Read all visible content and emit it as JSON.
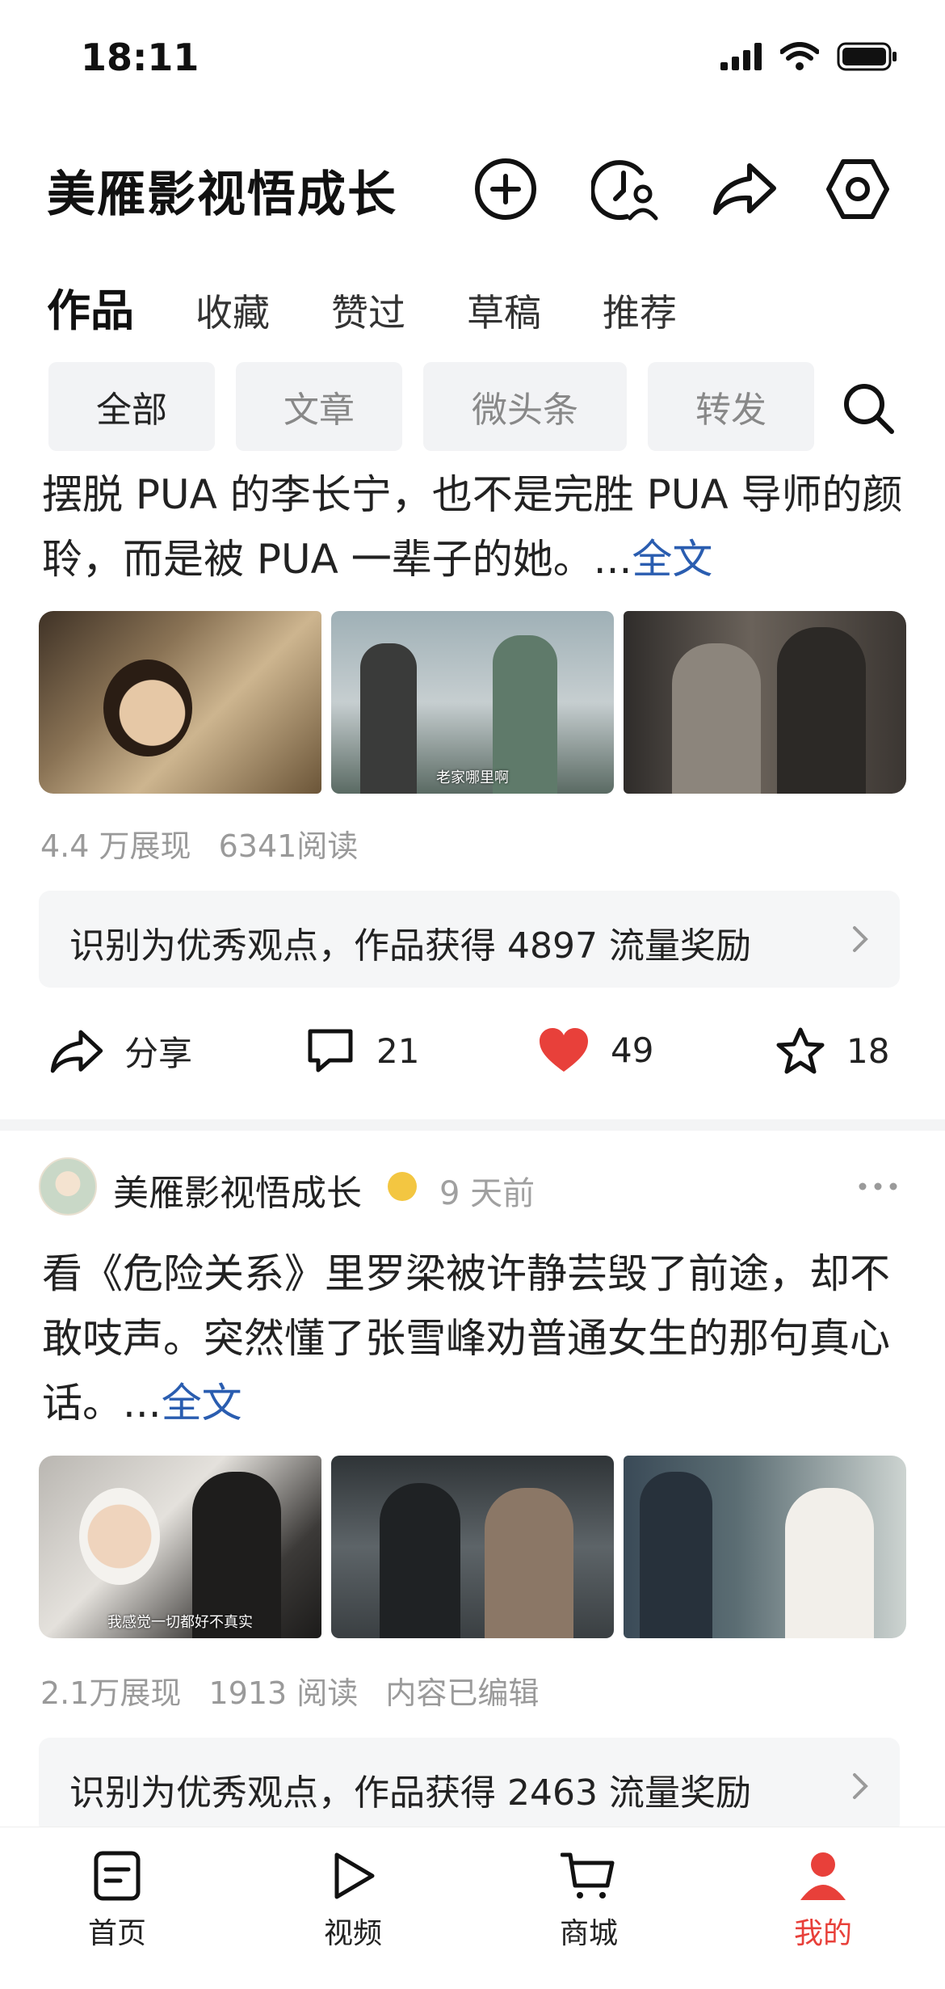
{
  "status_bar": {
    "time": "18:11"
  },
  "header": {
    "title": "美雁影视悟成长"
  },
  "tabs": [
    {
      "label": "作品",
      "active": true
    },
    {
      "label": "收藏"
    },
    {
      "label": "赞过"
    },
    {
      "label": "草稿"
    },
    {
      "label": "推荐"
    }
  ],
  "filters": [
    {
      "label": "全部",
      "active": true
    },
    {
      "label": "文章"
    },
    {
      "label": "微头条"
    },
    {
      "label": "转发"
    }
  ],
  "post1": {
    "text": "摆脱 PUA 的李长宁，也不是完胜 PUA 导师的颜聆，而是被 PUA 一辈子的她。...",
    "more": "全文",
    "image_caption": "老家哪里啊",
    "views": "4.4 万展现",
    "reads": "6341阅读",
    "reward": "识别为优秀观点，作品获得 4897 流量奖励",
    "share_label": "分享",
    "comments": "21",
    "likes": "49",
    "favorites": "18"
  },
  "post2": {
    "author": "美雁影视悟成长",
    "time_ago": "9 天前",
    "text": "看《危险关系》里罗梁被许静芸毁了前途，却不敢吱声。突然懂了张雪峰劝普通女生的那句真心话。...",
    "more": "全文",
    "image_caption": "我感觉一切都好不真实",
    "views": "2.1万展现",
    "reads": "1913 阅读",
    "edited": "内容已编辑",
    "reward": "识别为优秀观点，作品获得 2463 流量奖励"
  },
  "bottom_nav": [
    {
      "label": "首页"
    },
    {
      "label": "视频"
    },
    {
      "label": "商城"
    },
    {
      "label": "我的",
      "active": true
    }
  ],
  "colors": {
    "accent": "#e8403a",
    "link": "#2a5db0",
    "like": "#e8403a"
  }
}
